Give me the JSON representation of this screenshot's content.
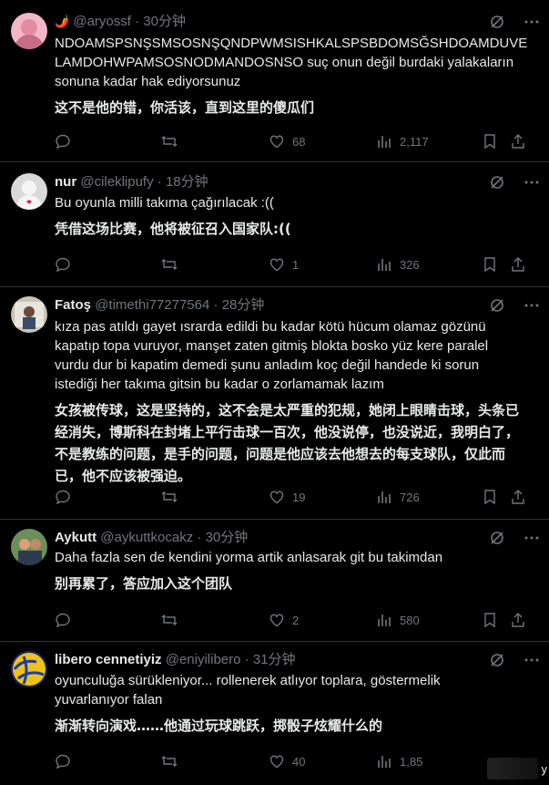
{
  "tweets": [
    {
      "name": "",
      "emoji": "🌶️",
      "handle": "@aryossf",
      "time": "30分钟",
      "lines": [
        "NDOAMSPSNŞSMSOSNŞQNDPWMSISHKALSPSBDOMSĞSHDOAMDUVE",
        "LAMDOHWPAMSOSNODMANDOSNSO suç onun değil burdaki yalakaların",
        "sonuna kadar hak ediyorsunuz"
      ],
      "translation": [
        "这不是他的错，你活该，直到这里的傻瓜们"
      ],
      "likes": "68",
      "views": "2,117",
      "avatar_color": "#f3b6c6"
    },
    {
      "name": "nur",
      "handle": "@cileklipufy",
      "time": "18分钟",
      "lines": [
        "Bu oyunla milli takıma çağırılacak :(("
      ],
      "translation": [
        "凭借这场比赛，他将被征召入国家队:(("
      ],
      "likes": "1",
      "views": "326",
      "avatar_color": "#d9d9d9"
    },
    {
      "name": "Fatoş",
      "handle": "@timethi77277564",
      "time": "28分钟",
      "lines": [
        "kıza pas atıldı gayet ısrarda edildi bu kadar kötü hücum olamaz gözünü",
        "kapatıp topa vuruyor, manşet zaten gitmiş blokta bosko yüz kere paralel",
        "vurdu dur bi kapatim demedi şunu anladım koç değil handede ki sorun",
        "istediği her takıma gitsin bu kadar o zorlamamak lazım"
      ],
      "translation": [
        "女孩被传球，这是坚持的，这不会是太严重的犯规，她闭上眼睛击球，头条已",
        "经消失，博斯科在封堵上平行击球一百次，他没说停，也没说近，我明白了，",
        "不是教练的问题，是手的问题，问题是他应该去他想去的每支球队，仅此而",
        "已，他不应该被强迫。"
      ],
      "likes": "19",
      "views": "726",
      "avatar_color": "#c9c2b6"
    },
    {
      "name": "Aykutt",
      "handle": "@aykuttkocakz",
      "time": "30分钟",
      "lines": [
        "Daha fazla sen de kendini yorma artik anlasarak git bu takimdan"
      ],
      "translation": [
        "别再累了，答应加入这个团队"
      ],
      "likes": "2",
      "views": "580",
      "avatar_color": "#6b8e5a"
    },
    {
      "name": "libero cennetiyiz",
      "handle": "@eniyilibero",
      "time": "31分钟",
      "lines": [
        "oyunculuğa sürükleniyor... rollenerek atlıyor toplara, göstermelik",
        "yuvarlanıyor falan"
      ],
      "translation": [
        "渐渐转向演戏……他通过玩球跳跃，掷骰子炫耀什么的"
      ],
      "likes": "40",
      "views": "1,85",
      "avatar_color": "#f2c21b"
    }
  ],
  "corner_text": "y"
}
